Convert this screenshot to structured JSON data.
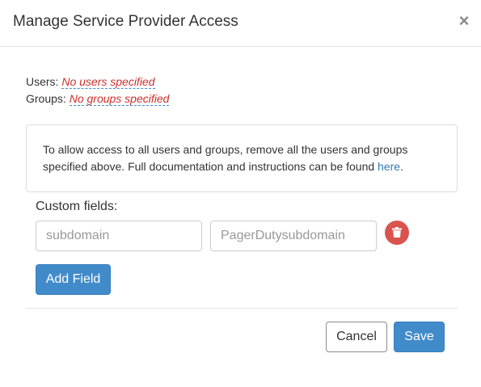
{
  "modal": {
    "title": "Manage Service Provider Access",
    "close_glyph": "×",
    "close_icon": "close-icon"
  },
  "access": {
    "users_label": "Users:",
    "users_value": "No users specified",
    "groups_label": "Groups:",
    "groups_value": "No groups specified"
  },
  "info": {
    "text": "To allow access to all users and groups, remove all the users and groups specified above. Full documentation and instructions can be found ",
    "link": "here",
    "suffix": "."
  },
  "custom_fields": {
    "label": "Custom fields:",
    "rows": [
      {
        "key_placeholder": "subdomain",
        "value_placeholder": "PagerDutysubdomain",
        "delete_icon": "trash-icon"
      }
    ],
    "add_label": "Add Field"
  },
  "footer": {
    "cancel_label": "Cancel",
    "save_label": "Save"
  },
  "colors": {
    "primary": "#428bca",
    "danger": "#d9534f",
    "empty_value": "#c9302c",
    "link": "#337ab7"
  }
}
